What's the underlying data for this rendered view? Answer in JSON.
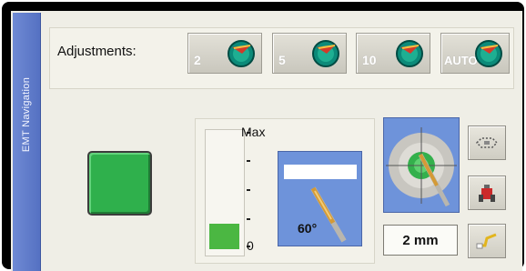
{
  "panel": {
    "side_tab_title": "EMT Navigation"
  },
  "adjustments": {
    "label": "Adjustments:",
    "buttons": [
      {
        "label": "2",
        "icon": "globe-compass-icon"
      },
      {
        "label": "5",
        "icon": "globe-compass-icon"
      },
      {
        "label": "10",
        "icon": "globe-compass-icon"
      },
      {
        "label": "AUTO",
        "icon": "globe-compass-icon"
      }
    ]
  },
  "status": {
    "indicator_color": "#2fb04c"
  },
  "gauge": {
    "max_label": "Max",
    "min_label": "0",
    "level_fraction": 0.22,
    "fill_color": "#4bb742"
  },
  "angle": {
    "value_label": "60°"
  },
  "target": {
    "distance_label": "2 mm"
  },
  "side_tools": [
    {
      "icon": "outline-view-icon"
    },
    {
      "icon": "red-marker-tool-icon"
    },
    {
      "icon": "path-curve-icon"
    }
  ]
}
